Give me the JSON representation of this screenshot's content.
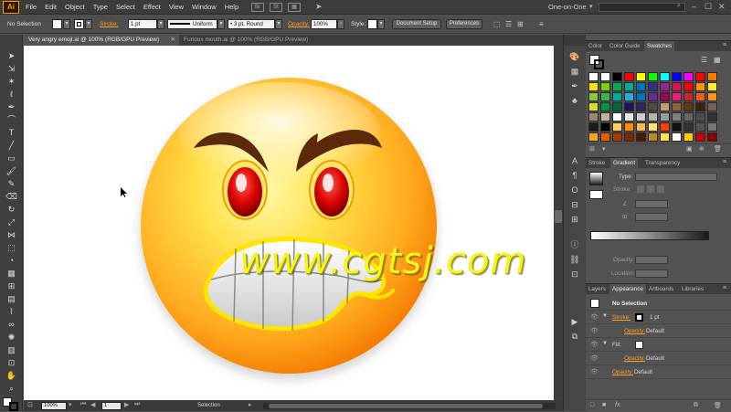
{
  "app": {
    "logo": "Ai",
    "menus": [
      "File",
      "Edit",
      "Object",
      "Type",
      "Select",
      "Effect",
      "View",
      "Window",
      "Help"
    ],
    "bridge_btn": "Br",
    "stock_btn": "St",
    "workspace": "One-on-One"
  },
  "control_bar": {
    "selection": "No Selection",
    "stroke_label": "Stroke:",
    "stroke_weight": "1 pt",
    "profile": "Uniform",
    "brush": "3 pt. Round",
    "opacity_label": "Opacity:",
    "opacity_value": "100%",
    "style_label": "Style:",
    "document_setup": "Document Setup",
    "preferences": "Preferences"
  },
  "document_tabs": [
    {
      "label": "Very angry emoji.ai @ 100% (RGB/GPU Preview)",
      "active": true
    },
    {
      "label": "Furious mouth.ai @ 100% (RGB/GPU Preview)",
      "active": false
    }
  ],
  "status_bar": {
    "zoom": "100%",
    "artboard": "1",
    "status": "Selection"
  },
  "watermark": "www.cgtsj.com",
  "panels": {
    "top_tabs": [
      "Color",
      "Color Guide",
      "Swatches"
    ],
    "top_active": "Swatches",
    "swatches": [
      "#ffffff",
      "#ffffff",
      "#000000",
      "#ff0000",
      "#ffff00",
      "#00ff00",
      "#00ffff",
      "#0000ff",
      "#ff00ff",
      "#ff0000",
      "#ff7a00",
      "#ffe100",
      "#7ad100",
      "#00b050",
      "#00a99d",
      "#0071bc",
      "#2e3192",
      "#93278f",
      "#d4145a",
      "#ff0000",
      "#ff9300",
      "#fcee21",
      "#8cc63f",
      "#39b54a",
      "#00a99d",
      "#29abe2",
      "#0071bc",
      "#662d91",
      "#9e005d",
      "#ed1e79",
      "#c1272d",
      "#f15a24",
      "#f7931e",
      "#d9e021",
      "#009245",
      "#006837",
      "#1b1464",
      "#29285b",
      "#534741",
      "#c69c6d",
      "#8c6239",
      "#603813",
      "#42210b",
      "#736357",
      "#998675",
      "#c7b299",
      "#ffffff",
      "#e6e6e6",
      "#cccccc",
      "#b3b3b3",
      "#999999",
      "#808080",
      "#666666",
      "#4d4d4d",
      "#333333",
      "#1a1a1a",
      "#000000",
      "#ffd05a",
      "#ff8a00",
      "#ffb84d",
      "#ffe36b",
      "#ff3b00",
      "#111111",
      "#333333",
      "#555555",
      "#777777",
      "#f7a51c",
      "#e85a00",
      "#a33d00",
      "#7a2b00",
      "#4a1a00",
      "#c0862a",
      "#ffdd55",
      "#ffffff",
      "#ffcc00",
      "#cc0000",
      "#880000"
    ],
    "mid_tabs": [
      "Stroke",
      "Gradient",
      "Transparency"
    ],
    "mid_active": "Gradient",
    "gradient": {
      "type_label": "Type:",
      "stroke_label": "Stroke:",
      "opacity_label": "Opacity:",
      "location_label": "Location:"
    },
    "bottom_tabs": [
      "Layers",
      "Appearance",
      "Artboards",
      "Libraries"
    ],
    "bottom_active": "Appearance",
    "appearance": {
      "title": "No Selection",
      "stroke_label": "Stroke:",
      "stroke_value": "1 pt",
      "stroke_opacity_label": "Opacity:",
      "stroke_opacity_value": "Default",
      "fill_label": "Fill:",
      "fill_opacity_label": "Opacity:",
      "fill_opacity_value": "Default",
      "opacity_label": "Opacity:",
      "opacity_value": "Default"
    }
  },
  "colors": {
    "accent": "#ff9a00",
    "face_gradient_center": "#fff176",
    "face_gradient_edge": "#f57c00",
    "eye_red": "#d40000",
    "teeth_outline": "#ffe900"
  }
}
